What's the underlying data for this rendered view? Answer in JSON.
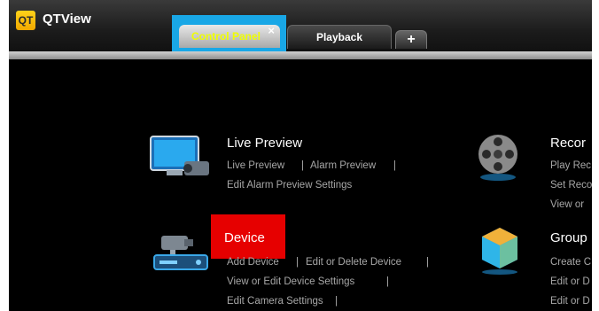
{
  "app": {
    "logo_text": "QT",
    "title": "QTView"
  },
  "tabs": [
    {
      "label": "Control Panel",
      "close": "×"
    },
    {
      "label": "Playback"
    },
    {
      "label": "+"
    }
  ],
  "features": {
    "live_preview": {
      "title": "Live Preview",
      "links": [
        "Live Preview",
        "Alarm Preview",
        "Edit Alarm Preview Settings"
      ],
      "separator": "|"
    },
    "record": {
      "title": "Recor",
      "links": [
        "Play Rec",
        "Set Reco",
        "View or"
      ]
    },
    "device": {
      "title": "Device",
      "links": [
        "Add Device",
        "Edit or Delete Device",
        "View or Edit Device Settings",
        "Edit Camera Settings"
      ],
      "separator": "|"
    },
    "group": {
      "title": "Group",
      "links": [
        "Create C",
        "Edit or D",
        "Edit or D"
      ]
    }
  },
  "colors": {
    "highlight_blue": "#19a7e6",
    "highlight_red": "#e60000",
    "active_tab_text": "#f0ff00"
  }
}
